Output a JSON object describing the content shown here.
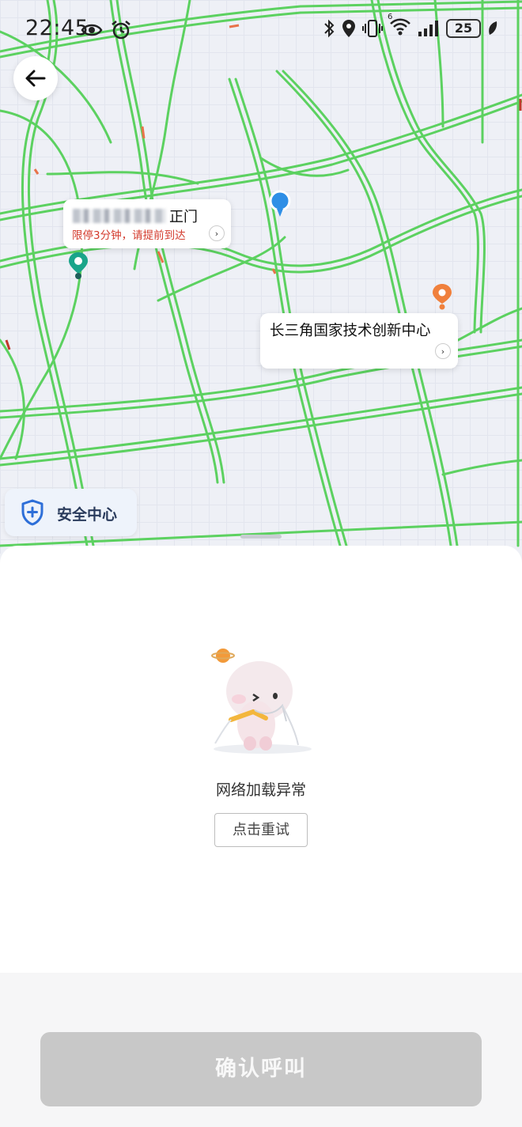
{
  "status_bar": {
    "time": "22:45",
    "battery": "25",
    "signal_label": "6",
    "icons": [
      "eye-icon",
      "alarm-icon",
      "bluetooth-icon",
      "location-icon",
      "vibrate-icon",
      "wifi-icon",
      "signal-icon",
      "battery-icon",
      "leaf-icon"
    ]
  },
  "map": {
    "start": {
      "name_suffix": "正门",
      "note": "限停3分钟，请提前到达"
    },
    "destination": {
      "name": "长三角国家技术创新中心"
    },
    "safety_center": {
      "label": "安全中心"
    },
    "colors": {
      "road_traffic": "#5cd160",
      "start_pin": "#1aa58a",
      "end_pin": "#f0803c",
      "current_location": "#2f8fe6"
    }
  },
  "sheet": {
    "error_message": "网络加载异常",
    "retry_label": "点击重试"
  },
  "footer": {
    "confirm_label": "确认呼叫",
    "confirm_color": "#c8c8c8"
  }
}
